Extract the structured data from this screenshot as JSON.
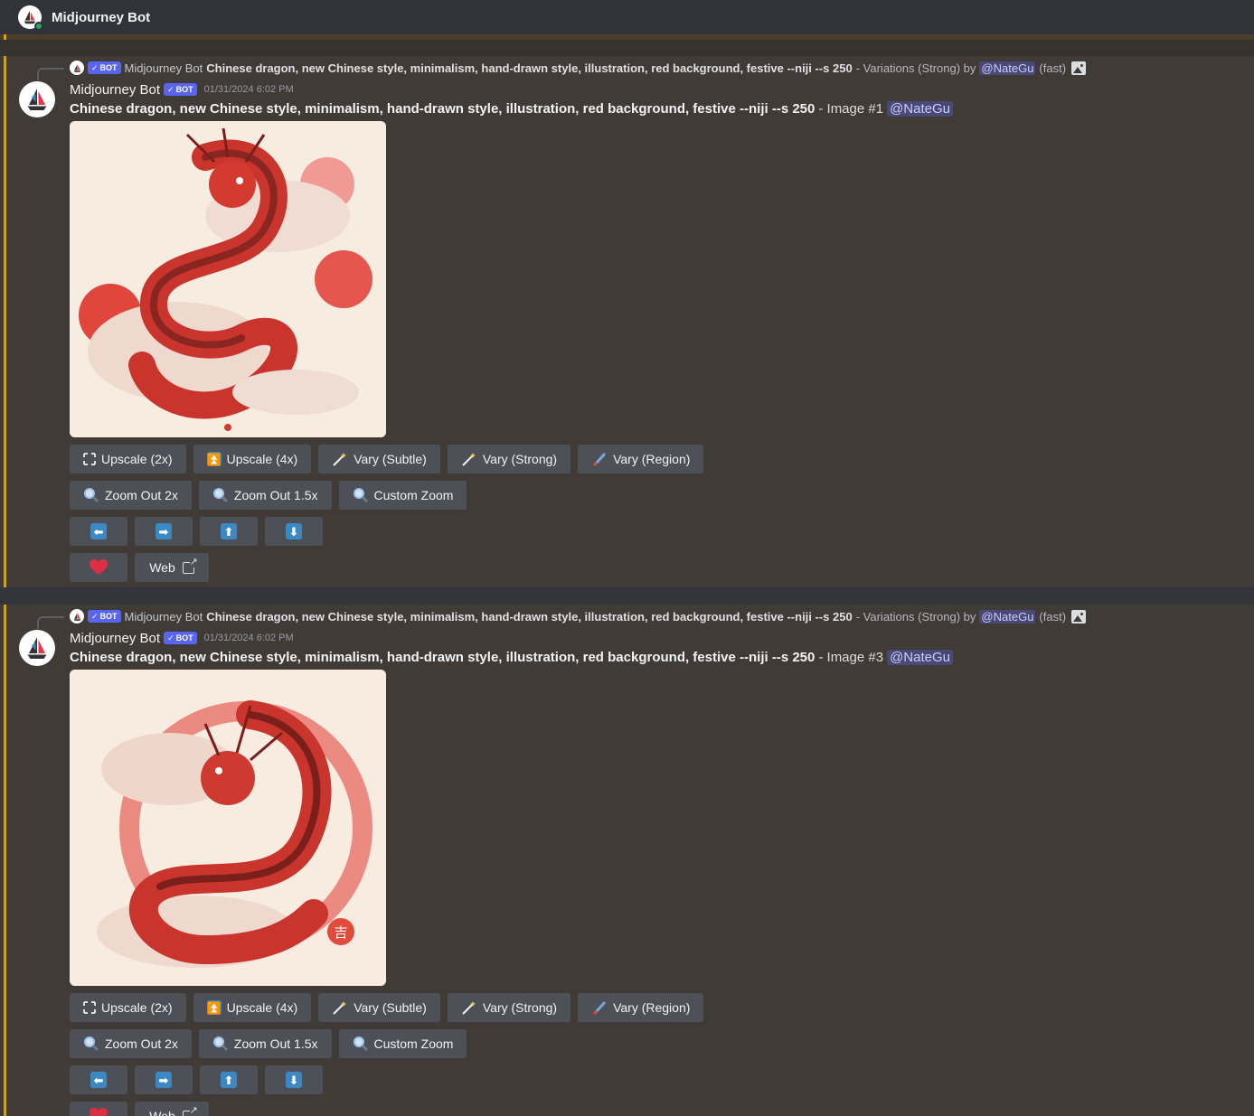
{
  "channel": {
    "title": "Midjourney Bot"
  },
  "colors": {
    "accent_bar": "#c9a227",
    "badge": "#5865f2",
    "button": "#4e5058",
    "arrow_icon": "#3b88c3"
  },
  "messages": [
    {
      "reply": {
        "bot_badge": "BOT",
        "name": "Midjourney Bot",
        "prompt": "Chinese dragon, new Chinese style, minimalism, hand-drawn style, illustration, red background, festive --niji --s 250",
        "rest": "- Variations (Strong) by",
        "mention": "@NateGu",
        "speed": "(fast)"
      },
      "author": "Midjourney Bot",
      "bot_badge": "BOT",
      "timestamp": "01/31/2024 6:02 PM",
      "prompt": "Chinese dragon, new Chinese style, minimalism, hand-drawn style, illustration, red background, festive --niji --s 250",
      "image_label": "- Image #1",
      "mention": "@NateGu",
      "buttons": {
        "upscale2": "Upscale (2x)",
        "upscale4": "Upscale (4x)",
        "vary_subtle": "Vary (Subtle)",
        "vary_strong": "Vary (Strong)",
        "vary_region": "Vary (Region)",
        "zoom2": "Zoom Out 2x",
        "zoom15": "Zoom Out 1.5x",
        "custom_zoom": "Custom Zoom",
        "web": "Web"
      }
    },
    {
      "reply": {
        "bot_badge": "BOT",
        "name": "Midjourney Bot",
        "prompt": "Chinese dragon, new Chinese style, minimalism, hand-drawn style, illustration, red background, festive --niji --s 250",
        "rest": "- Variations (Strong) by",
        "mention": "@NateGu",
        "speed": "(fast)"
      },
      "author": "Midjourney Bot",
      "bot_badge": "BOT",
      "timestamp": "01/31/2024 6:02 PM",
      "prompt": "Chinese dragon, new Chinese style, minimalism, hand-drawn style, illustration, red background, festive --niji --s 250",
      "image_label": "- Image #3",
      "mention": "@NateGu",
      "buttons": {
        "upscale2": "Upscale (2x)",
        "upscale4": "Upscale (4x)",
        "vary_subtle": "Vary (Subtle)",
        "vary_strong": "Vary (Strong)",
        "vary_region": "Vary (Region)",
        "zoom2": "Zoom Out 2x",
        "zoom15": "Zoom Out 1.5x",
        "custom_zoom": "Custom Zoom",
        "web": "Web"
      }
    }
  ]
}
